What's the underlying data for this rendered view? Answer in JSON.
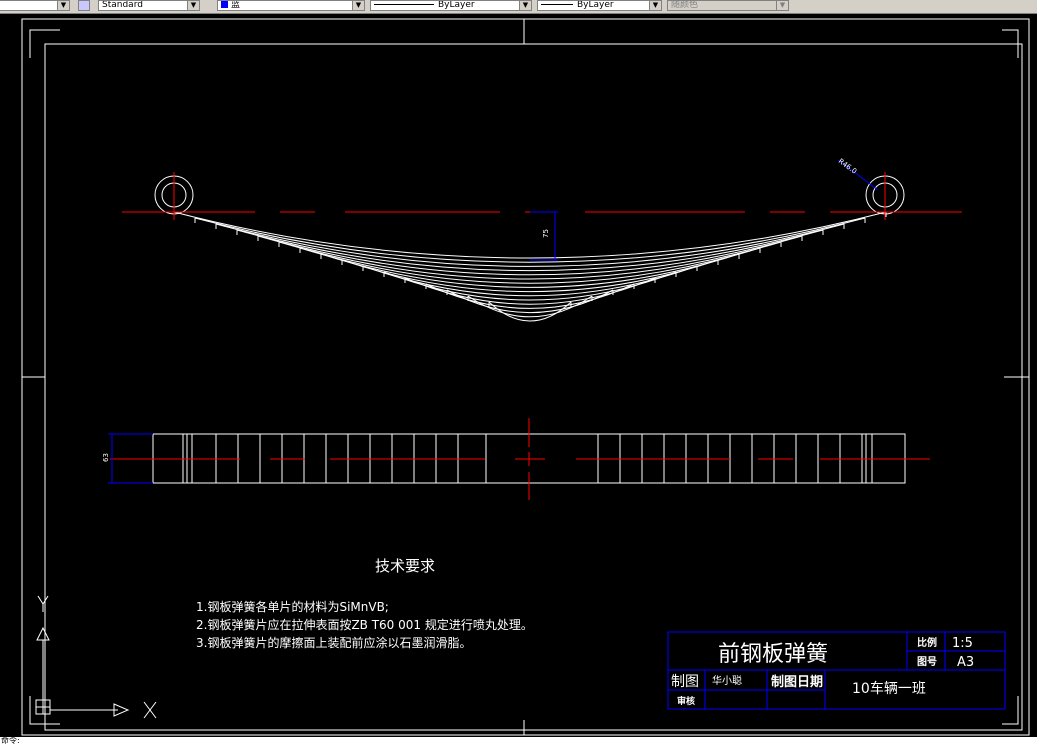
{
  "toolbar": {
    "textstyle_value": "Standard",
    "color_value": "蓝",
    "linetype_value": "ByLayer",
    "lineweight_value": "ByLayer",
    "plotstyle_value": "随颜色"
  },
  "drawing": {
    "radius_dim": "R46.0",
    "height_dim": "75",
    "width_dim": "63",
    "notes": {
      "title": "技术要求",
      "items": [
        "1.钢板弹簧各单片的材料为SiMnVB;",
        "2.钢板弹簧片应在拉伸表面按ZB  T60  001  规定进行喷丸处理。",
        "3.钢板弹簧片的摩擦面上装配前应涂以石墨润滑脂。"
      ]
    },
    "title_block": {
      "part_name": "前钢板弹簧",
      "scale_label": "比例",
      "scale_value": "1:5",
      "sheet_label": "图号",
      "sheet_value": "A3",
      "drawn_label": "制图",
      "drawn_by": "华小聪",
      "date_label": "制图日期",
      "class_name": "10车辆一班",
      "review_label": "审核"
    },
    "ucs_labels": {
      "y": "Y",
      "x": "X"
    }
  },
  "command_line": {
    "text": "命令: "
  },
  "colors": {
    "background": "#000000",
    "geometry": "#ffffff",
    "centerline": "#ff0000",
    "dimension": "#0000ff",
    "title_block": "#0000ff"
  }
}
